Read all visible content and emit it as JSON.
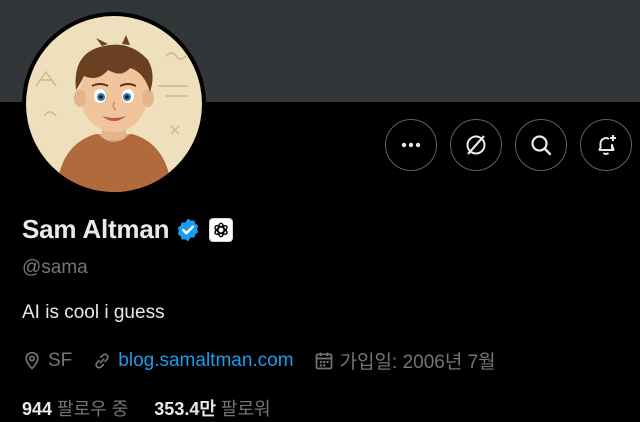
{
  "profile": {
    "name": "Sam Altman",
    "handle": "@sama",
    "bio": "AI is cool i guess",
    "location": "SF",
    "website": "blog.samaltman.com",
    "joined": "가입일: 2006년 7월"
  },
  "stats": {
    "following_count": "944",
    "following_label": "팔로우 중",
    "followers_count": "353.4만",
    "followers_label": "팔로워"
  },
  "actions": [
    "more-icon",
    "grok-icon",
    "search-icon",
    "notification-add-icon"
  ],
  "icons": {
    "verified": "verified-badge-icon",
    "affiliation": "openai-logo-icon",
    "location": "location-pin-icon",
    "link": "link-icon",
    "calendar": "calendar-icon"
  },
  "colors": {
    "background": "#000000",
    "banner": "#333639",
    "text_primary": "#e7e9ea",
    "text_secondary": "#71767b",
    "accent": "#1d9bf0",
    "button_border": "#536471"
  }
}
